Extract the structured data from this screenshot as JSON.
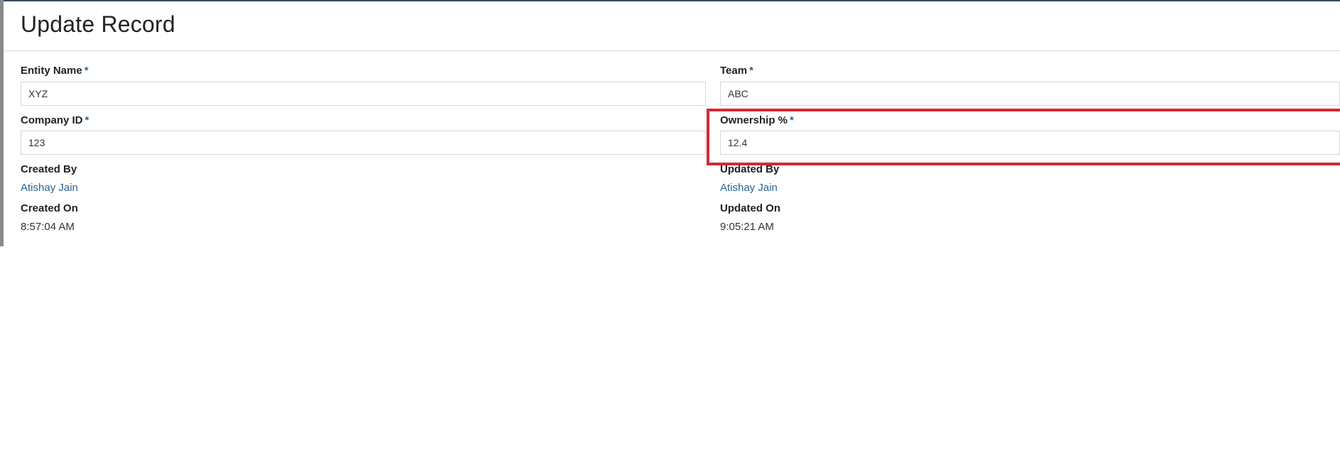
{
  "page": {
    "title": "Update Record"
  },
  "form": {
    "required_marker": "*",
    "entity_name": {
      "label": "Entity Name",
      "value": "XYZ"
    },
    "team": {
      "label": "Team",
      "value": "ABC"
    },
    "company_id": {
      "label": "Company ID",
      "value": "123"
    },
    "ownership": {
      "label": "Ownership %",
      "value": "12.4"
    }
  },
  "audit": {
    "created_by": {
      "label": "Created By",
      "value": "Atishay Jain"
    },
    "updated_by": {
      "label": "Updated By",
      "value": "Atishay Jain"
    },
    "created_on": {
      "label": "Created On",
      "value": "8:57:04 AM"
    },
    "updated_on": {
      "label": "Updated On",
      "value": "9:05:21 AM"
    }
  },
  "colors": {
    "highlight": "#d42a33",
    "link": "#2a6496",
    "required": "#2a6496"
  }
}
